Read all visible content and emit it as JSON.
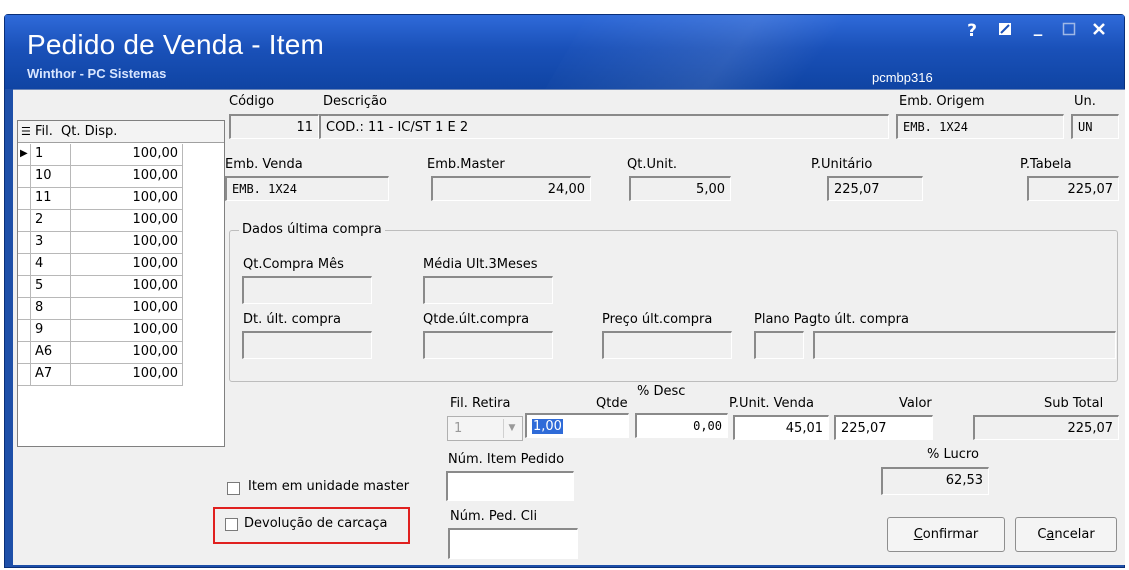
{
  "window": {
    "title": "Pedido de Venda - Item",
    "subtitle": "Winthor - PC Sistemas",
    "code": "pcmbp316",
    "buttons": {
      "help": "?",
      "min": "_"
    }
  },
  "grid": {
    "headers": {
      "fil": "Fil.",
      "qt": "Qt. Disp."
    },
    "rows": [
      {
        "fil": "1",
        "qt": "100,00"
      },
      {
        "fil": "10",
        "qt": "100,00"
      },
      {
        "fil": "11",
        "qt": "100,00"
      },
      {
        "fil": "2",
        "qt": "100,00"
      },
      {
        "fil": "3",
        "qt": "100,00"
      },
      {
        "fil": "4",
        "qt": "100,00"
      },
      {
        "fil": "5",
        "qt": "100,00"
      },
      {
        "fil": "8",
        "qt": "100,00"
      },
      {
        "fil": "9",
        "qt": "100,00"
      },
      {
        "fil": "A6",
        "qt": "100,00"
      },
      {
        "fil": "A7",
        "qt": "100,00"
      }
    ]
  },
  "product": {
    "codigo_label": "Código",
    "codigo": "11",
    "descricao_label": "Descrição",
    "descricao": "COD.: 11 - IC/ST 1 E 2",
    "emb_origem_label": "Emb. Origem",
    "emb_origem": "EMB. 1X24",
    "un_label": "Un.",
    "un": "UN",
    "emb_venda_label": "Emb. Venda",
    "emb_venda": "EMB. 1X24",
    "emb_master_label": "Emb.Master",
    "emb_master": "24,00",
    "qt_unit_label": "Qt.Unit.",
    "qt_unit": "5,00",
    "p_unitario_label": "P.Unitário",
    "p_unitario": "225,07",
    "p_tabela_label": "P.Tabela",
    "p_tabela": "225,07"
  },
  "ultima_compra": {
    "title": "Dados última compra",
    "qt_compra_mes": "Qt.Compra Mês",
    "media_3meses": "Média Ult.3Meses",
    "dt_ult_compra": "Dt. últ. compra",
    "qtde_ult_compra": "Qtde.últ.compra",
    "preco_ult_compra": "Preço últ.compra",
    "plano_pagto": "Plano Pagto últ. compra"
  },
  "venda": {
    "desc_label": "% Desc",
    "fil_retira_label": "Fil. Retira",
    "fil_retira": "1",
    "qtde_label": "Qtde",
    "qtde": "1,00",
    "desc_value": "0,00",
    "p_unit_venda_label": "P.Unit. Venda",
    "p_unit_venda": "45,01",
    "valor_label": "Valor",
    "valor": "225,07",
    "sub_total_label": "Sub Total",
    "sub_total": "225,07",
    "num_item_label": "Núm. Item Pedido",
    "lucro_label": "% Lucro",
    "lucro": "62,53",
    "num_ped_cli_label": "Núm. Ped. Cli"
  },
  "options": {
    "item_master": "Item em unidade master",
    "devolucao": "Devolução de carcaça"
  },
  "actions": {
    "confirmar_u": "C",
    "confirmar_rest": "onfirmar",
    "cancelar_pre": "C",
    "cancelar_u": "a",
    "cancelar_rest": "ncelar"
  },
  "colors": {
    "title_bg": "#1a51b9",
    "highlight": "#e0201f",
    "selection": "#2f6bd8"
  }
}
